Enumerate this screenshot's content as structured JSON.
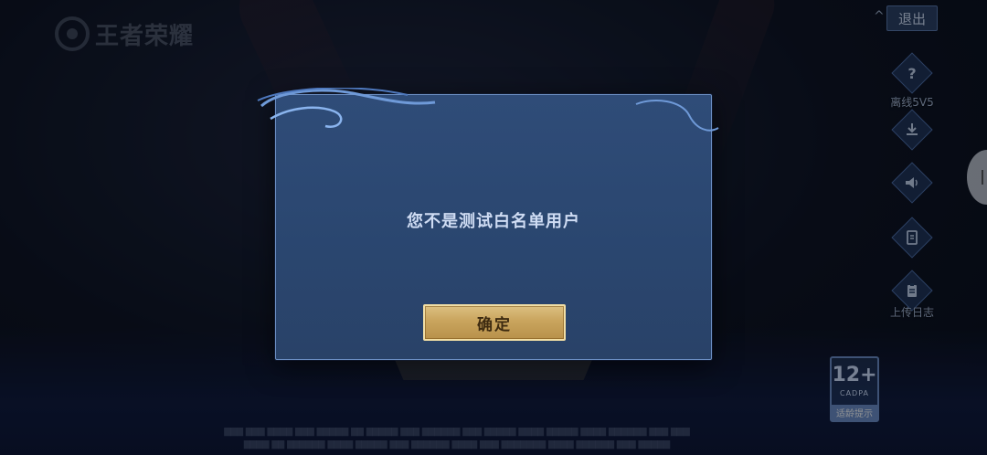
{
  "logo": {
    "text": "王者荣耀"
  },
  "top_right": {
    "exit_label": "退出",
    "collapse_glyph": "^"
  },
  "side_menu": [
    {
      "icon": "question-icon",
      "label": "离线5V5"
    },
    {
      "icon": "download-icon",
      "label": ""
    },
    {
      "icon": "speaker-icon",
      "label": ""
    },
    {
      "icon": "card-icon",
      "label": ""
    },
    {
      "icon": "clipboard-icon",
      "label": "上传日志"
    }
  ],
  "dialog": {
    "message": "您不是测试白名单用户",
    "confirm_label": "确定"
  },
  "age_rating": {
    "number": "12+",
    "org": "CADPA",
    "note": "适龄提示"
  },
  "colors": {
    "dialog_bg": "#2c4870",
    "dialog_border": "#6c8fc4",
    "confirm_gold": "#c9a45d",
    "exit_bg": "#304670"
  }
}
